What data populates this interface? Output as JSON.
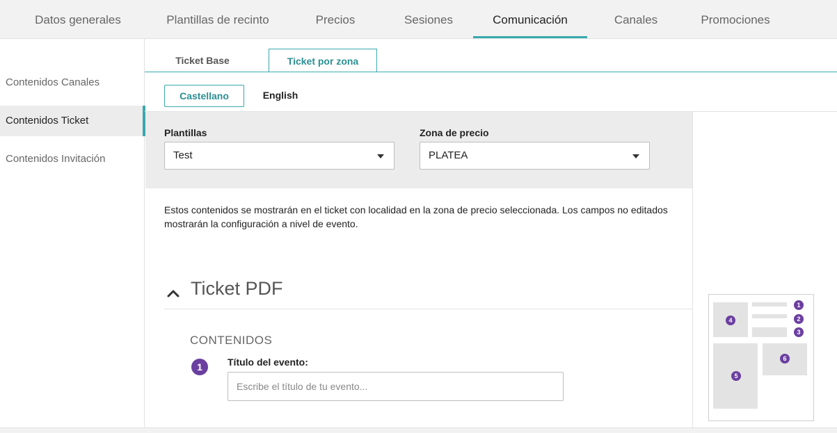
{
  "top_nav": {
    "tabs": [
      {
        "label": "Datos generales"
      },
      {
        "label": "Plantillas de recinto"
      },
      {
        "label": "Precios"
      },
      {
        "label": "Sesiones"
      },
      {
        "label": "Comunicación",
        "active": true
      },
      {
        "label": "Canales"
      },
      {
        "label": "Promociones"
      }
    ]
  },
  "sidebar": {
    "items": [
      {
        "label": "Contenidos Canales"
      },
      {
        "label": "Contenidos Ticket",
        "active": true
      },
      {
        "label": "Contenidos Invitación"
      }
    ]
  },
  "sub_tabs": [
    {
      "label": "Ticket Base"
    },
    {
      "label": "Ticket por zona",
      "active": true
    }
  ],
  "languages": [
    {
      "label": "Castellano",
      "active": true
    },
    {
      "label": "English"
    }
  ],
  "filters": {
    "templates_label": "Plantillas",
    "templates_value": "Test",
    "zone_label": "Zona de precio",
    "zone_value": "PLATEA"
  },
  "info_text": "Estos contenidos se mostrarán en el ticket con localidad en la zona de precio seleccionada. Los campos no editados mostrarán la configuración a nivel de evento.",
  "section": {
    "title": "Ticket PDF",
    "contents_label": "CONTENIDOS",
    "fields": [
      {
        "number": "1",
        "label": "Título del evento:",
        "placeholder": "Escribe el título de tu evento...",
        "value": ""
      }
    ]
  },
  "preview": {
    "markers": [
      "1",
      "2",
      "3",
      "4",
      "5",
      "6"
    ]
  },
  "colors": {
    "accent": "#3aa9ad",
    "badge": "#6b3fa0"
  },
  "icons": [
    "chevron-up-icon",
    "chevron-down-icon"
  ]
}
